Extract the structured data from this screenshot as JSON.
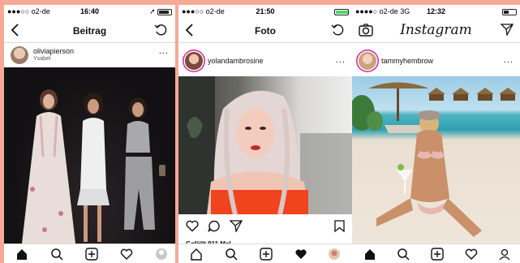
{
  "panels": [
    {
      "status": {
        "carrier": "●●●○○ o2-de",
        "time": "16:40",
        "battery_icon": "battery-icon"
      },
      "nav": {
        "title": "Beitrag",
        "back_icon": "chevron-left-icon",
        "refresh_icon": "refresh-icon"
      },
      "post": {
        "username": "oliviapierson",
        "location": "Ysabel",
        "more": "..."
      },
      "tabs": [
        "home-icon",
        "search-icon",
        "add-icon",
        "heart-icon",
        "profile-icon"
      ]
    },
    {
      "status": {
        "carrier": "●●●○○ o2-de",
        "time": "21:50",
        "battery_icon": "battery-icon"
      },
      "nav": {
        "title": "Foto",
        "back_icon": "chevron-left-icon",
        "refresh_icon": "refresh-icon"
      },
      "post": {
        "username": "yolandambrosine",
        "more": "...",
        "likes": "Gefällt 911 Mal"
      },
      "actions": [
        "heart-icon",
        "comment-icon",
        "send-icon",
        "bookmark-icon"
      ],
      "tabs": [
        "home-icon",
        "search-icon",
        "add-icon",
        "heart-icon",
        "profile-icon"
      ]
    },
    {
      "status": {
        "carrier": "●●●●○ o2-de  3G",
        "time": "12:32",
        "battery_icon": "battery-icon"
      },
      "nav": {
        "title": "Instagram",
        "camera_icon": "camera-icon",
        "send_icon": "send-icon"
      },
      "post": {
        "username": "tammyhembrow",
        "more": "..."
      },
      "tabs": [
        "home-icon",
        "search-icon",
        "add-icon",
        "heart-icon",
        "profile-icon"
      ]
    }
  ],
  "colors": {
    "background": "#f5a996",
    "ig_ring": "#d6249f",
    "text": "#111111"
  }
}
